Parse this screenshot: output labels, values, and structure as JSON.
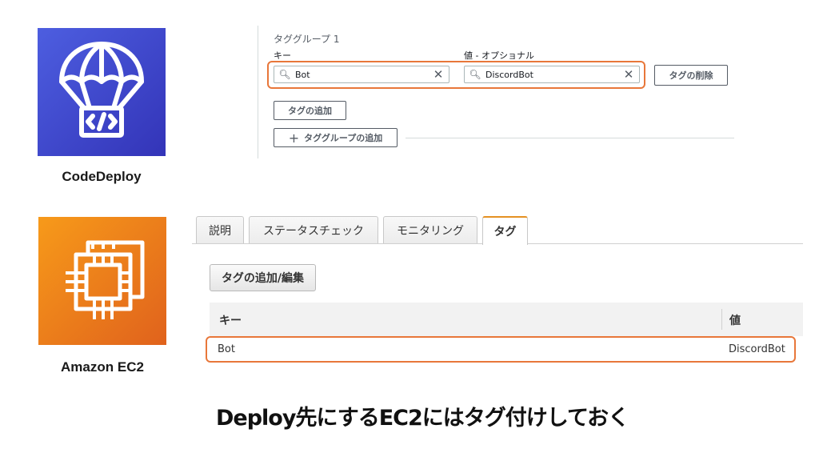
{
  "services": {
    "codedeploy": {
      "label": "CodeDeploy",
      "icon": "parachute-code-icon",
      "color": "#3f48cc"
    },
    "ec2": {
      "label": "Amazon EC2",
      "icon": "chip-icon",
      "color": "#ec7211"
    }
  },
  "tag_group": {
    "title": "タググループ 1",
    "key_label": "キー",
    "value_label": "値 - オプショナル",
    "key_value": "Bot",
    "value_value": "DiscordBot",
    "delete_button": "タグの削除",
    "add_tag_button": "タグの追加",
    "add_group_button": "タググループの追加"
  },
  "ec2_panel": {
    "tabs": [
      "説明",
      "ステータスチェック",
      "モニタリング",
      "タグ"
    ],
    "active_tab": "タグ",
    "edit_button": "タグの追加/編集",
    "columns": [
      "キー",
      "値"
    ],
    "rows": [
      {
        "key": "Bot",
        "value": "DiscordBot"
      }
    ]
  },
  "caption": "Deploy先にするEC2にはタグ付けしておく",
  "colors": {
    "highlight": "#e8773a",
    "tab_accent": "#e59122"
  }
}
